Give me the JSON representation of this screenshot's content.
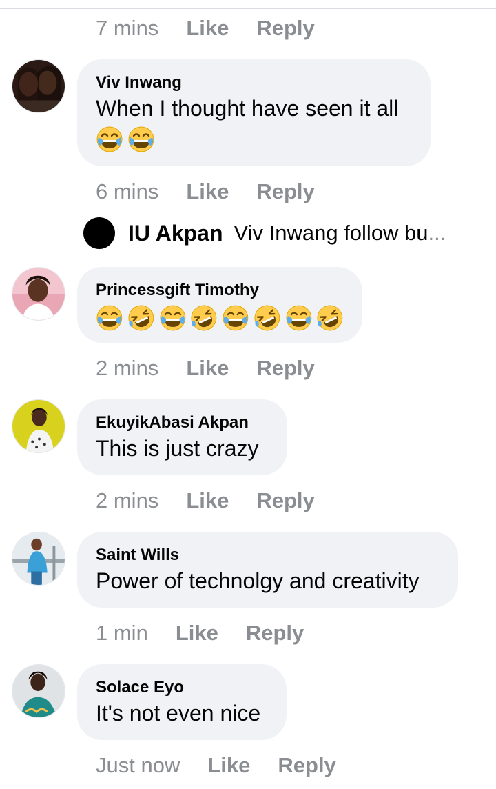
{
  "actions_top": {
    "time": "7 mins",
    "like": "Like",
    "reply": "Reply"
  },
  "comments": [
    {
      "name": "Viv Inwang",
      "text": "When I thought have seen it all",
      "emojis": [
        "joy",
        "joy"
      ],
      "actions": {
        "time": "6 mins",
        "like": "Like",
        "reply": "Reply"
      }
    },
    {
      "name": "Princessgift Timothy",
      "text": "",
      "emojis": [
        "joy",
        "rofl",
        "joy",
        "rofl",
        "joy",
        "rofl",
        "joy",
        "rofl"
      ],
      "actions": {
        "time": "2 mins",
        "like": "Like",
        "reply": "Reply"
      }
    },
    {
      "name": "EkuyikAbasi Akpan",
      "text": "This is just crazy",
      "actions": {
        "time": "2 mins",
        "like": "Like",
        "reply": "Reply"
      }
    },
    {
      "name": "Saint Wills",
      "text": "Power of technolgy and creativity",
      "actions": {
        "time": "1 min",
        "like": "Like",
        "reply": "Reply"
      }
    },
    {
      "name": "Solace Eyo",
      "text": "It's not even nice",
      "actions": {
        "time": "Just now",
        "like": "Like",
        "reply": "Reply"
      }
    }
  ],
  "reply_preview": {
    "name": "IU Akpan",
    "text": "Viv Inwang follow bu",
    "ellipsis": "..."
  },
  "colors": {
    "bubble": "#f0f2f5",
    "meta": "#8a8d91",
    "text": "#050505",
    "emoji_face": "#ffcc4d"
  }
}
